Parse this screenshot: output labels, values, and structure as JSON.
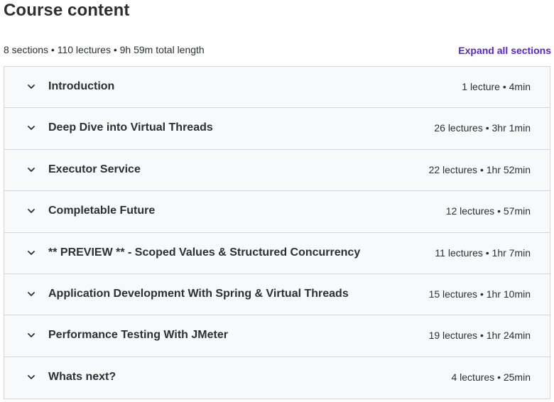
{
  "header": {
    "title": "Course content",
    "summary": "8 sections • 110 lectures • 9h 59m total length",
    "expand_all_label": "Expand all sections"
  },
  "sections": [
    {
      "title": "Introduction",
      "meta": "1 lecture • 4min",
      "icon": "chevron-down-icon"
    },
    {
      "title": "Deep Dive into Virtual Threads",
      "meta": "26 lectures • 3hr 1min",
      "icon": "chevron-down-icon"
    },
    {
      "title": "Executor Service",
      "meta": "22 lectures • 1hr 52min",
      "icon": "chevron-down-icon"
    },
    {
      "title": "Completable Future",
      "meta": "12 lectures • 57min",
      "icon": "chevron-down-icon"
    },
    {
      "title": "** PREVIEW ** - Scoped Values & Structured Concurrency",
      "meta": "11 lectures • 1hr 7min",
      "icon": "chevron-down-icon"
    },
    {
      "title": "Application Development With Spring & Virtual Threads",
      "meta": "15 lectures • 1hr 10min",
      "icon": "chevron-down-icon"
    },
    {
      "title": "Performance Testing With JMeter",
      "meta": "19 lectures • 1hr 24min",
      "icon": "chevron-down-icon"
    },
    {
      "title": "Whats next?",
      "meta": "4 lectures • 25min",
      "icon": "chevron-down-icon"
    }
  ],
  "colors": {
    "accent": "#5624d0",
    "text": "#2d2f31",
    "section_bg": "#f7f9fa",
    "border": "#d1d7dc"
  }
}
